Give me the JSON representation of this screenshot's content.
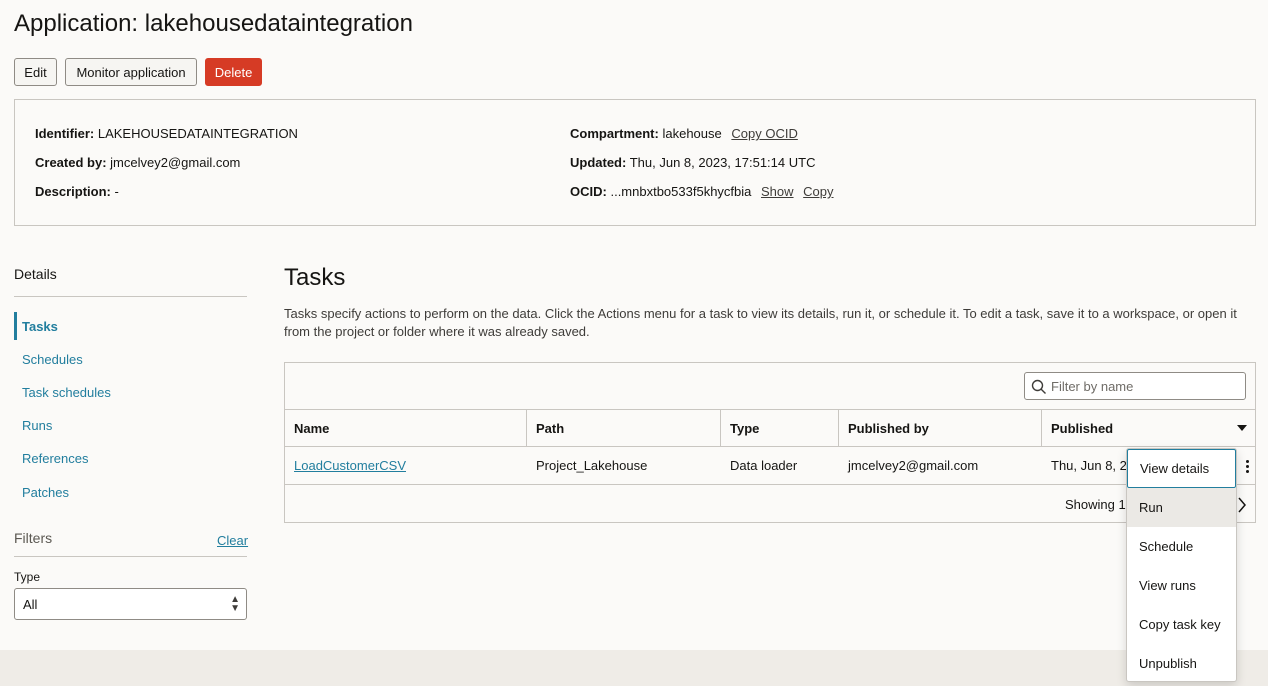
{
  "header": {
    "title": "Application: lakehousedataintegration",
    "buttons": {
      "edit": "Edit",
      "monitor": "Monitor application",
      "delete": "Delete"
    }
  },
  "info": {
    "identifier_label": "Identifier:",
    "identifier_value": "LAKEHOUSEDATAINTEGRATION",
    "created_by_label": "Created by:",
    "created_by_value": "jmcelvey2@gmail.com",
    "description_label": "Description:",
    "description_value": "-",
    "compartment_label": "Compartment:",
    "compartment_value": "lakehouse",
    "copy_ocid_link": "Copy OCID",
    "updated_label": "Updated:",
    "updated_value": "Thu, Jun 8, 2023, 17:51:14 UTC",
    "ocid_label": "OCID:",
    "ocid_value": "...mnbxtbo533f5khycfbia",
    "show_link": "Show",
    "copy_link": "Copy"
  },
  "sidebar": {
    "title": "Details",
    "items": [
      {
        "label": "Tasks",
        "active": true
      },
      {
        "label": "Schedules"
      },
      {
        "label": "Task schedules"
      },
      {
        "label": "Runs"
      },
      {
        "label": "References"
      },
      {
        "label": "Patches"
      }
    ],
    "filters_title": "Filters",
    "clear_label": "Clear",
    "type_label": "Type",
    "type_value": "All"
  },
  "tasks": {
    "title": "Tasks",
    "description": "Tasks specify actions to perform on the data. Click the Actions menu for a task to view its details, run it, or schedule it. To edit a task, save it to a workspace, or open it from the project or folder where it was already saved.",
    "filter_placeholder": "Filter by name",
    "columns": [
      "Name",
      "Path",
      "Type",
      "Published by",
      "Published"
    ],
    "rows": [
      {
        "name": "LoadCustomerCSV",
        "path": "Project_Lakehouse",
        "type": "Data loader",
        "published_by": "jmcelvey2@gmail.com",
        "published": "Thu, Jun 8, 2"
      }
    ],
    "showing": "Showing 1"
  },
  "actions_menu": {
    "items": [
      "View details",
      "Run",
      "Schedule",
      "View runs",
      "Copy task key",
      "Unpublish"
    ]
  },
  "colors": {
    "accent": "#227e9e",
    "delete": "#d63b25"
  }
}
